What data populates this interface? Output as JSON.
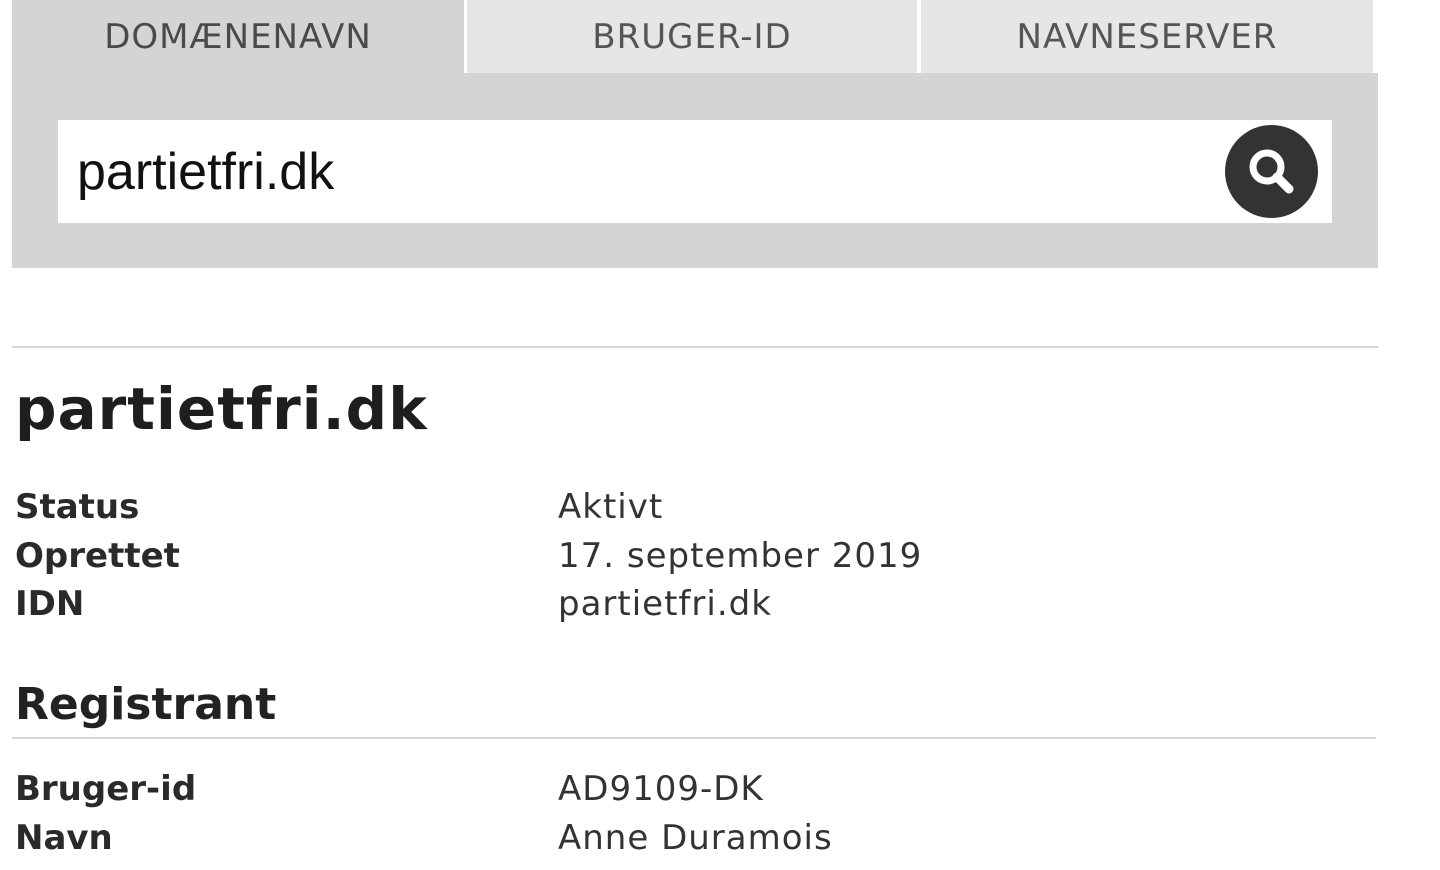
{
  "tabs": [
    {
      "label": "DOMÆNENAVN",
      "active": true
    },
    {
      "label": "BRUGER-ID",
      "active": false
    },
    {
      "label": "NAVNESERVER",
      "active": false
    }
  ],
  "search": {
    "value": "partietfri.dk",
    "button_icon": "search-icon"
  },
  "domain": {
    "title": "partietfri.dk",
    "rows": [
      {
        "label": "Status",
        "value": "Aktivt"
      },
      {
        "label": "Oprettet",
        "value": "17. september 2019"
      },
      {
        "label": "IDN",
        "value": "partietfri.dk"
      }
    ]
  },
  "registrant": {
    "title": "Registrant",
    "rows": [
      {
        "label": "Bruger-id",
        "value": "AD9109-DK"
      },
      {
        "label": "Navn",
        "value": "Anne Duramois"
      }
    ]
  },
  "colors": {
    "panel_bg": "#d4d4d6",
    "inactive_tab_bg": "#e6e6e8",
    "search_button": "#333333"
  }
}
